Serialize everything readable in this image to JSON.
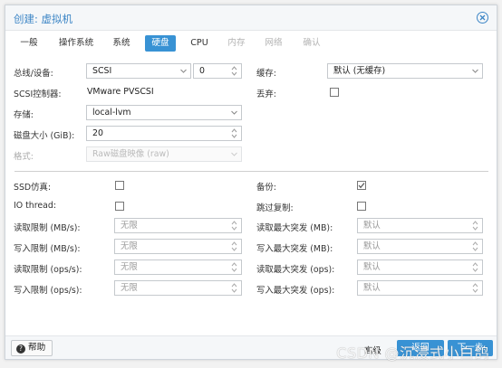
{
  "dialog": {
    "title": "创建: 虚拟机",
    "tabs": [
      {
        "label": "一般",
        "state": "normal"
      },
      {
        "label": "操作系统",
        "state": "normal"
      },
      {
        "label": "系统",
        "state": "normal"
      },
      {
        "label": "硬盘",
        "state": "active"
      },
      {
        "label": "CPU",
        "state": "normal"
      },
      {
        "label": "内存",
        "state": "disabled"
      },
      {
        "label": "网络",
        "state": "disabled"
      },
      {
        "label": "确认",
        "state": "disabled"
      }
    ]
  },
  "disk": {
    "bus_label": "总线/设备:",
    "bus_value": "SCSI",
    "device_number": "0",
    "scsi_ctrl_label": "SCSI控制器:",
    "scsi_ctrl_value": "VMware PVSCSI",
    "storage_label": "存储:",
    "storage_value": "local-lvm",
    "size_label": "磁盘大小 (GiB):",
    "size_value": "20",
    "format_label": "格式:",
    "format_value": "Raw磁盘映像 (raw)",
    "cache_label": "缓存:",
    "cache_value": "默认 (无缓存)",
    "discard_label": "丢弃:",
    "discard_checked": false
  },
  "advanced": {
    "ssd_label": "SSD仿真:",
    "ssd_checked": false,
    "iothread_label": "IO thread:",
    "iothread_checked": false,
    "backup_label": "备份:",
    "backup_checked": true,
    "skip_replication_label": "跳过复制:",
    "skip_replication_checked": false,
    "read_limit_mb_label": "读取限制 (MB/s):",
    "write_limit_mb_label": "写入限制 (MB/s):",
    "read_limit_ops_label": "读取限制 (ops/s):",
    "write_limit_ops_label": "写入限制 (ops/s):",
    "read_burst_mb_label": "读取最大突发 (MB):",
    "write_burst_mb_label": "写入最大突发 (MB):",
    "read_burst_ops_label": "读取最大突发 (ops):",
    "write_burst_ops_label": "写入最大突发 (ops):",
    "unlimited_placeholder": "无限",
    "default_placeholder": "默认"
  },
  "footer": {
    "help_label": "帮助",
    "advanced_label": "高级",
    "back_label": "返回",
    "next_label": "下一步"
  },
  "watermark": "CSDN @沉浸式小白鸽",
  "colors": {
    "accent": "#3892d4",
    "title": "#3d86c6"
  },
  "icons": {
    "close": "close-circle-icon",
    "help": "question-circle-icon",
    "dropdown": "chevron-down-icon",
    "spinner": "spinner-arrows-icon"
  }
}
